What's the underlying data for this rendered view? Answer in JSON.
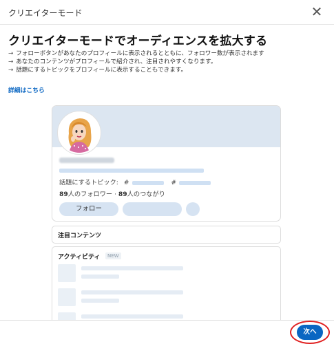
{
  "dialog": {
    "title": "クリエイターモード",
    "close_symbol": "✕"
  },
  "intro": {
    "heading": "クリエイターモードでオーディエンスを拡大する",
    "bullets": [
      "フォローボタンがあなたのプロフィールに表示されるとともに、フォロワー数が表示されます",
      "あなたのコンテンツがプロフィールで紹介され、注目されやすくなります。",
      "話題にするトピックをプロフィールに表示することもできます。"
    ],
    "arrow_symbol": "→",
    "learn_more": "詳細はこちら"
  },
  "preview": {
    "topics_label": "話題にするトピック:",
    "hash": "#",
    "follower_count": "89",
    "follower_text": "人のフォロワー · ",
    "connection_count": "89",
    "connection_text": "人のつながり",
    "follow_button": "フォロー",
    "featured_label": "注目コンテンツ",
    "activity_label": "アクティビティ",
    "new_badge": "NEW"
  },
  "footer": {
    "next_button": "次へ"
  },
  "colors": {
    "accent": "#0a66c2",
    "banner": "#dce6f1",
    "highlight": "#e02020"
  }
}
